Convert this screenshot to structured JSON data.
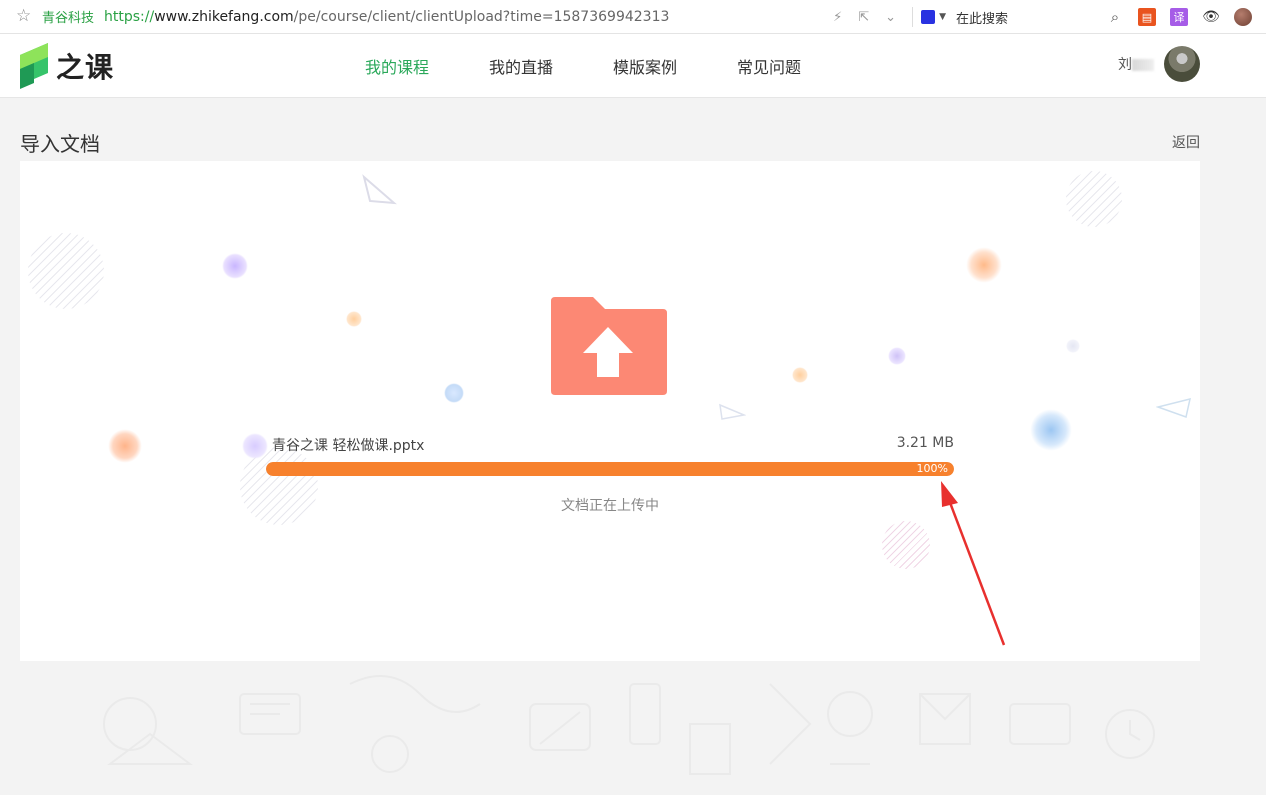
{
  "browser": {
    "site_name": "青谷科技",
    "url_scheme": "https://",
    "url_host": "www.zhikefang.com",
    "url_path": "/pe/course/client/clientUpload?time=1587369942313",
    "search_placeholder": "在此搜索",
    "translate_label": "译"
  },
  "header": {
    "logo_text": "之课",
    "nav": [
      {
        "label": "我的课程",
        "active": true
      },
      {
        "label": "我的直播",
        "active": false
      },
      {
        "label": "模版案例",
        "active": false
      },
      {
        "label": "常见问题",
        "active": false
      }
    ],
    "username": "刘"
  },
  "page": {
    "title": "导入文档",
    "back_label": "返回"
  },
  "upload": {
    "file_name": "青谷之课 轻松做课.pptx",
    "file_size": "3.21 MB",
    "progress": 100,
    "progress_label": "100%",
    "status_text": "文档正在上传中"
  },
  "colors": {
    "accent_green": "#2aa85a",
    "progress_orange": "#f7812d",
    "folder_coral": "#fc8874",
    "annotation_red": "#e8302e"
  }
}
